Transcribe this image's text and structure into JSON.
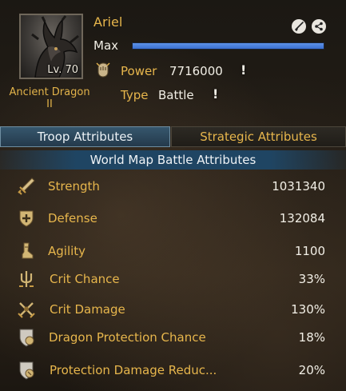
{
  "header": {
    "player_name": "Ariel",
    "level_label": "Lv. 70",
    "dragon_name": "Ancient Dragon II",
    "max_label": "Max",
    "progress": 1.0,
    "power_label": "Power",
    "power_value": "7716000",
    "type_label": "Type",
    "type_value": "Battle",
    "info_mark": "!"
  },
  "tabs": [
    {
      "label": "Troop Attributes",
      "active": true
    },
    {
      "label": "Strategic Attributes",
      "active": false
    }
  ],
  "section_title": "World Map Battle Attributes",
  "attributes": [
    {
      "label": "Strength",
      "value": "1031340",
      "icon": "sword-icon"
    },
    {
      "label": "Defense",
      "value": "132084",
      "icon": "shield-plus-icon"
    },
    {
      "label": "Agility",
      "value": "1100",
      "icon": "boot-icon"
    },
    {
      "label": "Crit Chance",
      "value": "33%",
      "icon": "trident-icon"
    },
    {
      "label": "Crit Damage",
      "value": "130%",
      "icon": "crossed-swords-icon"
    },
    {
      "label": "Dragon Protection Chance",
      "value": "18%",
      "icon": "shield-dragon-icon"
    },
    {
      "label": "Protection Damage Reduc...",
      "value": "20%",
      "icon": "shield-reduce-icon"
    }
  ],
  "colors": {
    "gold": "#e7b64c",
    "blue_bar": "#3b6fd0",
    "tab_active": "#36576d",
    "section_header": "#1f4563"
  }
}
